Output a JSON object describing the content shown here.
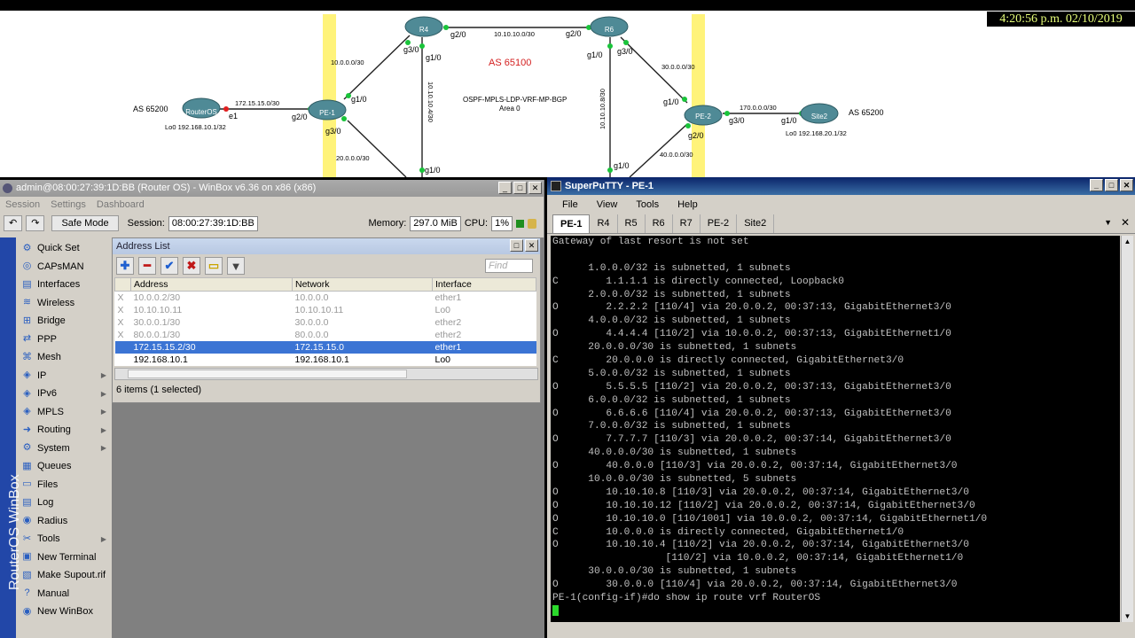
{
  "clock": "4:20:56 p.m. 02/10/2019",
  "topology": {
    "as_left": "AS 65200",
    "as_right": "AS 65200",
    "as_center": "AS 65100",
    "center_proto": "OSPF-MPLS-LDP-VRF-MP-BGP",
    "center_area": "Area 0",
    "routers": {
      "routeros": "RouterOS",
      "pe1": "PE-1",
      "r4": "R4",
      "r6": "R6",
      "pe2": "PE-2",
      "site2": "Site2"
    },
    "lo_left": "Lo0 192.168.10.1/32",
    "lo_right": "Lo0 192.168.20.1/32",
    "links": {
      "l_ros_pe1": "172.15.15.0/30",
      "l_pe1_r4": "10.0.0.0/30",
      "l_pe1_down": "20.0.0.0/30",
      "l_r4_r6": "10.10.10.0/30",
      "l_r4_down": "10.10.10.4/30",
      "l_r6_down": "10.10.10.8/30",
      "l_r6_pe2": "30.0.0.0/30",
      "l_pe2_down": "40.0.0.0/30",
      "l_pe2_site2": "170.0.0.0/30"
    },
    "ifaces": {
      "ros_e1": "e1",
      "pe1_g20": "g2/0",
      "pe1_g10": "g1/0",
      "pe1_g30": "g3/0",
      "r4_g30": "g3/0",
      "r4_g10": "g1/0",
      "r4_g20": "g2/0",
      "r6_g20": "g2/0",
      "r6_g10": "g1/0",
      "r6_g30": "g3/0",
      "pe2_g10": "g1/0",
      "pe2_g20": "g2/0",
      "pe2_g30": "g3/0",
      "site2_g10": "g1/0",
      "bottom_g10_a": "g1/0",
      "bottom_g10_b": "g1/0"
    }
  },
  "winbox": {
    "title": "admin@08:00:27:39:1D:BB (Router OS) - WinBox v6.36 on x86 (x86)",
    "menu": [
      "Session",
      "Settings",
      "Dashboard"
    ],
    "safe_mode": "Safe Mode",
    "session_label": "Session:",
    "session_value": "08:00:27:39:1D:BB",
    "memory_label": "Memory:",
    "memory_value": "297.0 MiB",
    "cpu_label": "CPU:",
    "cpu_value": "1%",
    "brand": "RouterOS WinBox",
    "sidebar": [
      {
        "label": "Quick Set",
        "icon": "quick-set-icon",
        "sub": false
      },
      {
        "label": "CAPsMAN",
        "icon": "capsman-icon",
        "sub": false
      },
      {
        "label": "Interfaces",
        "icon": "interfaces-icon",
        "sub": false
      },
      {
        "label": "Wireless",
        "icon": "wireless-icon",
        "sub": false
      },
      {
        "label": "Bridge",
        "icon": "bridge-icon",
        "sub": false
      },
      {
        "label": "PPP",
        "icon": "ppp-icon",
        "sub": false
      },
      {
        "label": "Mesh",
        "icon": "mesh-icon",
        "sub": false
      },
      {
        "label": "IP",
        "icon": "ip-icon",
        "sub": true
      },
      {
        "label": "IPv6",
        "icon": "ipv6-icon",
        "sub": true
      },
      {
        "label": "MPLS",
        "icon": "mpls-icon",
        "sub": true
      },
      {
        "label": "Routing",
        "icon": "routing-icon",
        "sub": true
      },
      {
        "label": "System",
        "icon": "system-icon",
        "sub": true
      },
      {
        "label": "Queues",
        "icon": "queues-icon",
        "sub": false
      },
      {
        "label": "Files",
        "icon": "files-icon",
        "sub": false
      },
      {
        "label": "Log",
        "icon": "log-icon",
        "sub": false
      },
      {
        "label": "Radius",
        "icon": "radius-icon",
        "sub": false
      },
      {
        "label": "Tools",
        "icon": "tools-icon",
        "sub": true
      },
      {
        "label": "New Terminal",
        "icon": "terminal-icon",
        "sub": false
      },
      {
        "label": "Make Supout.rif",
        "icon": "supout-icon",
        "sub": false
      },
      {
        "label": "Manual",
        "icon": "manual-icon",
        "sub": false
      },
      {
        "label": "New WinBox",
        "icon": "winbox-icon",
        "sub": false
      }
    ],
    "address_list": {
      "title": "Address List",
      "find_placeholder": "Find",
      "columns": [
        "Address",
        "Network",
        "Interface"
      ],
      "rows": [
        {
          "flag": "X",
          "address": "10.0.0.2/30",
          "network": "10.0.0.0",
          "interface": "ether1",
          "state": "disabled"
        },
        {
          "flag": "X",
          "address": "10.10.10.11",
          "network": "10.10.10.11",
          "interface": "Lo0",
          "state": "disabled"
        },
        {
          "flag": "X",
          "address": "30.0.0.1/30",
          "network": "30.0.0.0",
          "interface": "ether2",
          "state": "disabled"
        },
        {
          "flag": "X",
          "address": "80.0.0.1/30",
          "network": "80.0.0.0",
          "interface": "ether2",
          "state": "disabled"
        },
        {
          "flag": "",
          "address": "172.15.15.2/30",
          "network": "172.15.15.0",
          "interface": "ether1",
          "state": "selected"
        },
        {
          "flag": "",
          "address": "192.168.10.1",
          "network": "192.168.10.1",
          "interface": "Lo0",
          "state": "normal"
        }
      ],
      "status": "6 items (1 selected)"
    }
  },
  "putty": {
    "title": "SuperPuTTY - PE-1",
    "menu": [
      "File",
      "View",
      "Tools",
      "Help"
    ],
    "tabs": [
      "PE-1",
      "R4",
      "R5",
      "R6",
      "R7",
      "PE-2",
      "Site2"
    ],
    "active_tab": "PE-1",
    "terminal_lines": [
      "Gateway of last resort is not set",
      "",
      "      1.0.0.0/32 is subnetted, 1 subnets",
      "C        1.1.1.1 is directly connected, Loopback0",
      "      2.0.0.0/32 is subnetted, 1 subnets",
      "O        2.2.2.2 [110/4] via 20.0.0.2, 00:37:13, GigabitEthernet3/0",
      "      4.0.0.0/32 is subnetted, 1 subnets",
      "O        4.4.4.4 [110/2] via 10.0.0.2, 00:37:13, GigabitEthernet1/0",
      "      20.0.0.0/30 is subnetted, 1 subnets",
      "C        20.0.0.0 is directly connected, GigabitEthernet3/0",
      "      5.0.0.0/32 is subnetted, 1 subnets",
      "O        5.5.5.5 [110/2] via 20.0.0.2, 00:37:13, GigabitEthernet3/0",
      "      6.0.0.0/32 is subnetted, 1 subnets",
      "O        6.6.6.6 [110/4] via 20.0.0.2, 00:37:13, GigabitEthernet3/0",
      "      7.0.0.0/32 is subnetted, 1 subnets",
      "O        7.7.7.7 [110/3] via 20.0.0.2, 00:37:14, GigabitEthernet3/0",
      "      40.0.0.0/30 is subnetted, 1 subnets",
      "O        40.0.0.0 [110/3] via 20.0.0.2, 00:37:14, GigabitEthernet3/0",
      "      10.0.0.0/30 is subnetted, 5 subnets",
      "O        10.10.10.8 [110/3] via 20.0.0.2, 00:37:14, GigabitEthernet3/0",
      "O        10.10.10.12 [110/2] via 20.0.0.2, 00:37:14, GigabitEthernet3/0",
      "O        10.10.10.0 [110/1001] via 10.0.0.2, 00:37:14, GigabitEthernet1/0",
      "C        10.0.0.0 is directly connected, GigabitEthernet1/0",
      "O        10.10.10.4 [110/2] via 20.0.0.2, 00:37:14, GigabitEthernet3/0",
      "                   [110/2] via 10.0.0.2, 00:37:14, GigabitEthernet1/0",
      "      30.0.0.0/30 is subnetted, 1 subnets",
      "O        30.0.0.0 [110/4] via 20.0.0.2, 00:37:14, GigabitEthernet3/0",
      "PE-1(config-if)#do show ip route vrf RouterOS"
    ]
  }
}
